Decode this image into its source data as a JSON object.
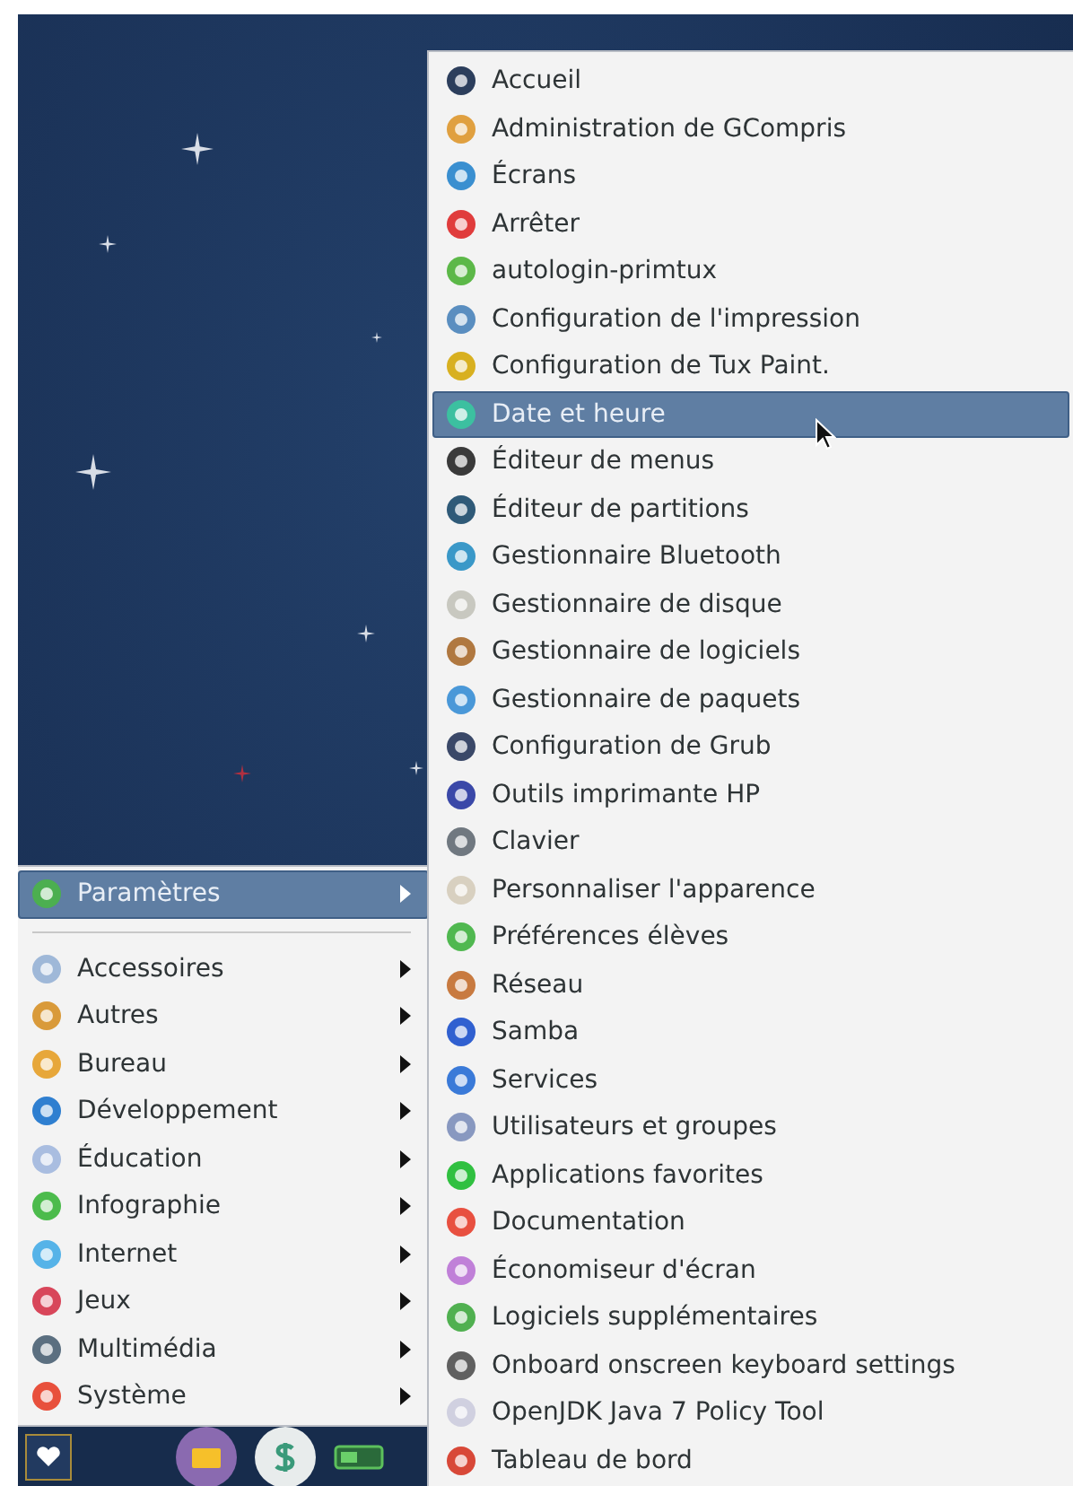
{
  "main_menu": {
    "pinned": [
      {
        "label": "Paramètres",
        "selected": true,
        "color": "#4caf50"
      }
    ],
    "items": [
      {
        "label": "Accessoires",
        "selected": false,
        "color": "#9fb8d8"
      },
      {
        "label": "Autres",
        "selected": false,
        "color": "#d99a3a"
      },
      {
        "label": "Bureau",
        "selected": false,
        "color": "#e7a73a"
      },
      {
        "label": "Développement",
        "selected": false,
        "color": "#2f7fd0"
      },
      {
        "label": "Éducation",
        "selected": false,
        "color": "#a9bde0"
      },
      {
        "label": "Infographie",
        "selected": false,
        "color": "#4cbb4c"
      },
      {
        "label": "Internet",
        "selected": false,
        "color": "#56b3e8"
      },
      {
        "label": "Jeux",
        "selected": false,
        "color": "#d8465a"
      },
      {
        "label": "Multimédia",
        "selected": false,
        "color": "#5b6f80"
      },
      {
        "label": "Système",
        "selected": false,
        "color": "#e8503c"
      }
    ]
  },
  "submenu": {
    "items": [
      {
        "label": "Accueil",
        "selected": false,
        "color": "#2c3e5c"
      },
      {
        "label": "Administration de GCompris",
        "selected": false,
        "color": "#e0a040"
      },
      {
        "label": "Écrans",
        "selected": false,
        "color": "#3a8fd0"
      },
      {
        "label": "Arrêter",
        "selected": false,
        "color": "#e03c3c"
      },
      {
        "label": "autologin-primtux",
        "selected": false,
        "color": "#5cb848"
      },
      {
        "label": "Configuration de l'impression",
        "selected": false,
        "color": "#5a8ec0"
      },
      {
        "label": "Configuration de Tux Paint.",
        "selected": false,
        "color": "#d8b020"
      },
      {
        "label": "Date et heure",
        "selected": true,
        "color": "#3cc0a0"
      },
      {
        "label": "Éditeur de menus",
        "selected": false,
        "color": "#3a3a3a"
      },
      {
        "label": "Éditeur de partitions",
        "selected": false,
        "color": "#2f5a78"
      },
      {
        "label": "Gestionnaire Bluetooth",
        "selected": false,
        "color": "#3a98c8"
      },
      {
        "label": "Gestionnaire de disque",
        "selected": false,
        "color": "#c8c8c0"
      },
      {
        "label": "Gestionnaire de logiciels",
        "selected": false,
        "color": "#b07840"
      },
      {
        "label": "Gestionnaire de paquets",
        "selected": false,
        "color": "#4a98d8"
      },
      {
        "label": "Configuration de Grub",
        "selected": false,
        "color": "#3a4868"
      },
      {
        "label": "Outils imprimante HP",
        "selected": false,
        "color": "#3a48a8"
      },
      {
        "label": "Clavier",
        "selected": false,
        "color": "#707880"
      },
      {
        "label": "Personnaliser l'apparence",
        "selected": false,
        "color": "#d8d0c0"
      },
      {
        "label": "Préférences élèves",
        "selected": false,
        "color": "#50b850"
      },
      {
        "label": "Réseau",
        "selected": false,
        "color": "#c87a40"
      },
      {
        "label": "Samba",
        "selected": false,
        "color": "#3060d0"
      },
      {
        "label": "Services",
        "selected": false,
        "color": "#3a7ad8"
      },
      {
        "label": "Utilisateurs et groupes",
        "selected": false,
        "color": "#8898c0"
      },
      {
        "label": "Applications favorites",
        "selected": false,
        "color": "#30c040"
      },
      {
        "label": "Documentation",
        "selected": false,
        "color": "#e85040"
      },
      {
        "label": "Économiseur d'écran",
        "selected": false,
        "color": "#c080d8"
      },
      {
        "label": "Logiciels supplémentaires",
        "selected": false,
        "color": "#50b050"
      },
      {
        "label": "Onboard onscreen keyboard settings",
        "selected": false,
        "color": "#606060"
      },
      {
        "label": "OpenJDK Java 7 Policy Tool",
        "selected": false,
        "color": "#d0d0e0"
      },
      {
        "label": "Tableau de bord",
        "selected": false,
        "color": "#d84838"
      }
    ]
  }
}
